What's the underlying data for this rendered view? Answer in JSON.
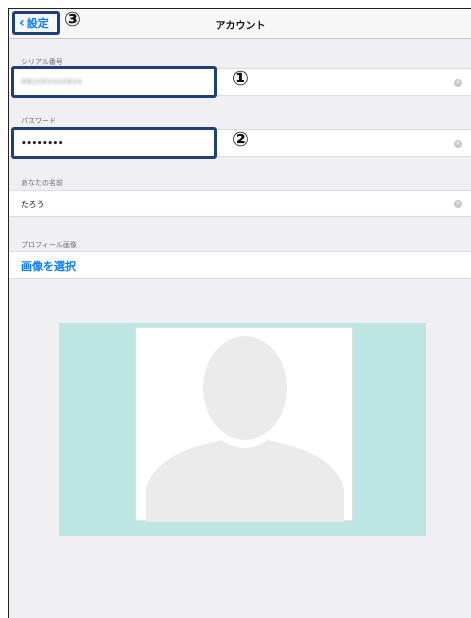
{
  "nav": {
    "back_label": "設定",
    "title": "アカウント"
  },
  "callouts": {
    "one": "①",
    "two": "②",
    "three": "③"
  },
  "fields": {
    "serial": {
      "label": "シリアル番号",
      "value": "MB20K0400834"
    },
    "password": {
      "label": "パスワード",
      "value": "••••••••"
    },
    "name": {
      "label": "あなたの名前",
      "value": "たろう"
    }
  },
  "profile": {
    "label": "プロフィール画像",
    "select_label": "画像を選択"
  },
  "colors": {
    "accent": "#0a7cff",
    "highlight": "#1f3f7a",
    "profile_background": "#bde6e3"
  },
  "icons": {
    "back": "chevron-left-icon",
    "clear": "clear-circle-icon",
    "avatar": "person-silhouette-icon"
  }
}
